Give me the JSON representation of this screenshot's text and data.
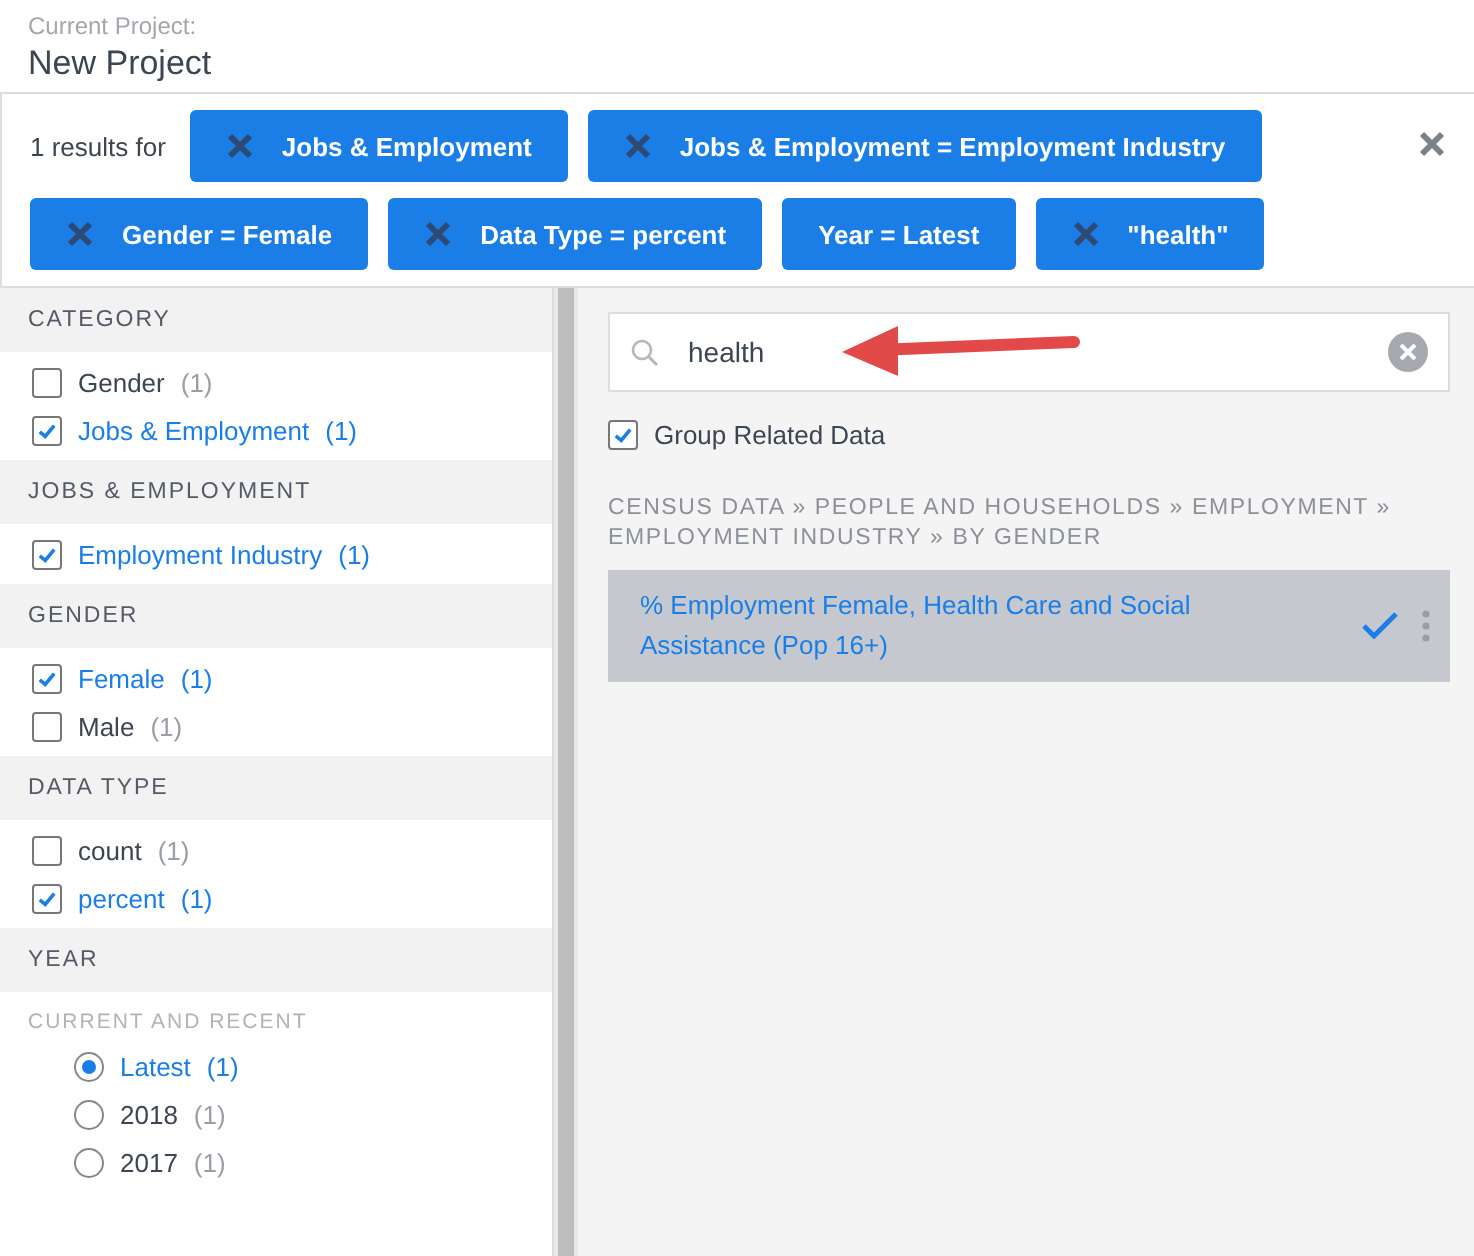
{
  "project": {
    "caption": "Current Project:",
    "name": "New Project"
  },
  "filters": {
    "summary": "1 results for",
    "chips": [
      {
        "label": "Jobs & Employment",
        "removable": true
      },
      {
        "label": "Jobs & Employment = Employment Industry",
        "removable": true
      },
      {
        "label": "Gender = Female",
        "removable": true
      },
      {
        "label": "Data Type = percent",
        "removable": true
      },
      {
        "label": "Year = Latest",
        "removable": false
      },
      {
        "label": "\"health\"",
        "removable": true
      }
    ]
  },
  "sidebar": {
    "sections": [
      {
        "title": "CATEGORY",
        "items": [
          {
            "kind": "checkbox",
            "label": "Gender",
            "count": "(1)",
            "checked": false
          },
          {
            "kind": "checkbox",
            "label": "Jobs & Employment",
            "count": "(1)",
            "checked": true
          }
        ]
      },
      {
        "title": "JOBS & EMPLOYMENT",
        "items": [
          {
            "kind": "checkbox",
            "label": "Employment Industry",
            "count": "(1)",
            "checked": true
          }
        ]
      },
      {
        "title": "GENDER",
        "items": [
          {
            "kind": "checkbox",
            "label": "Female",
            "count": "(1)",
            "checked": true
          },
          {
            "kind": "checkbox",
            "label": "Male",
            "count": "(1)",
            "checked": false
          }
        ]
      },
      {
        "title": "DATA TYPE",
        "items": [
          {
            "kind": "checkbox",
            "label": "count",
            "count": "(1)",
            "checked": false
          },
          {
            "kind": "checkbox",
            "label": "percent",
            "count": "(1)",
            "checked": true
          }
        ]
      },
      {
        "title": "YEAR",
        "subtitle": "CURRENT AND RECENT",
        "items": [
          {
            "kind": "radio",
            "label": "Latest",
            "count": "(1)",
            "checked": true
          },
          {
            "kind": "radio",
            "label": "2018",
            "count": "(1)",
            "checked": false
          },
          {
            "kind": "radio",
            "label": "2017",
            "count": "(1)",
            "checked": false
          }
        ]
      }
    ]
  },
  "search": {
    "value": "health"
  },
  "group_related": {
    "label": "Group Related Data",
    "checked": true
  },
  "results": [
    {
      "breadcrumb": "CENSUS DATA » PEOPLE AND HOUSEHOLDS » EMPLOYMENT » EMPLOYMENT INDUSTRY » BY GENDER",
      "title": "% Employment Female, Health Care and Social Assistance (Pop 16+)",
      "selected": true
    }
  ]
}
